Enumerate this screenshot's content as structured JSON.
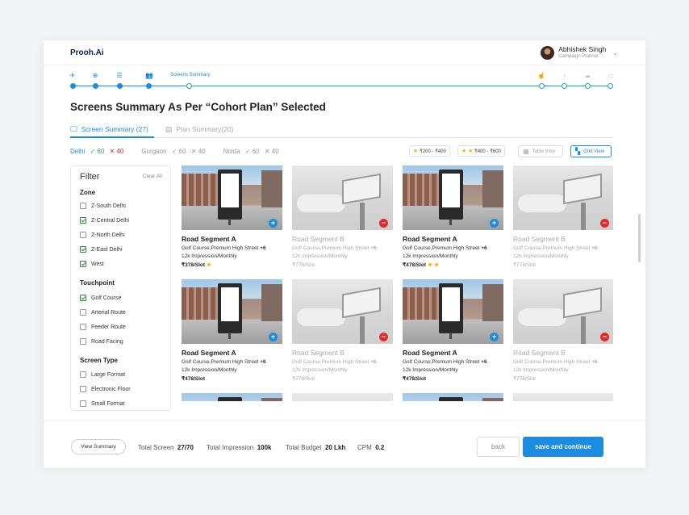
{
  "app": {
    "logo": "Prooh.Ai"
  },
  "user": {
    "name": "Abhishek Singh",
    "role": "Campaign Planner"
  },
  "stepper": {
    "current_label": "Screens Summary"
  },
  "page_title": "Screens Summary As Per “Cohort Plan” Selected",
  "tabs": [
    {
      "label": "Screen Summary (27)",
      "icon": "monitor-icon"
    },
    {
      "label": "Plan Summary(20)",
      "icon": "document-icon"
    }
  ],
  "cities": [
    {
      "name": "Delhi",
      "check": "✓ 60",
      "cross": "✕ 40"
    },
    {
      "name": "Gurgaon",
      "check": "✓ 60",
      "cross": "✕ 40"
    },
    {
      "name": "Noida",
      "check": "✓ 60",
      "cross": "✕ 40"
    }
  ],
  "price_filters": [
    "₹200 - ₹400",
    "₹400 - ₹600"
  ],
  "views": {
    "table": "Table View",
    "grid": "Grid View"
  },
  "filter": {
    "title": "Filter",
    "clear_all": "Clear All",
    "sections": [
      {
        "title": "Zone",
        "items": [
          {
            "label": "Z-South Delhi",
            "checked": false
          },
          {
            "label": "Z-Central Delhi",
            "checked": true
          },
          {
            "label": "Z-North Delhi",
            "checked": false
          },
          {
            "label": "Z-East Delhi",
            "checked": true
          },
          {
            "label": "West",
            "checked": true
          }
        ]
      },
      {
        "title": "Touchpoint",
        "items": [
          {
            "label": "Golf Course",
            "checked": true
          },
          {
            "label": "Arterial Route",
            "checked": false
          },
          {
            "label": " Feeder Route",
            "checked": false
          },
          {
            "label": "Road Facing",
            "checked": false
          }
        ]
      },
      {
        "title": "Screen Type",
        "items": [
          {
            "label": "Large Format",
            "checked": false
          },
          {
            "label": "Electronic Floor",
            "checked": false
          },
          {
            "label": "Small Format",
            "checked": false
          }
        ]
      }
    ]
  },
  "screens": [
    {
      "name": "Road Segment A",
      "location": "Golf Course,Premum High Street",
      "more": "+6",
      "impressions": "12k Impression/Monthly",
      "price": "₹378/Slot",
      "stars": 1,
      "selected": true
    },
    {
      "name": "Road Segment B",
      "location": "Golf Course,Premum High Street",
      "more": "+6",
      "impressions": "12k Impression/Monthly",
      "price": "₹778/Slot",
      "stars": 0,
      "selected": false
    },
    {
      "name": "Road Segment A",
      "location": "Golf Course,Premum High Street",
      "more": "+6",
      "impressions": "12k Impression/Monthly",
      "price": "₹478/Slot",
      "stars": 2,
      "selected": true
    },
    {
      "name": "Road Segment B",
      "location": "Golf Course,Premum High Street",
      "more": "+6",
      "impressions": "12k Impression/Monthly",
      "price": "₹778/Slot",
      "stars": 0,
      "selected": false
    },
    {
      "name": "Road Segment A",
      "location": "Golf Course,Premum High Street",
      "more": "+6",
      "impressions": "12k Impression/Monthly",
      "price": "₹478/Slot",
      "stars": 0,
      "selected": true
    },
    {
      "name": "Road Segment B",
      "location": "Golf Course,Premum High Street",
      "more": "+6",
      "impressions": "12k Impression/Monthly",
      "price": "₹778/Slot",
      "stars": 0,
      "selected": false
    },
    {
      "name": "Road Segment A",
      "location": "Golf Course,Premum High Street",
      "more": "+6",
      "impressions": "12k Impression/Monthly",
      "price": "₹478/Slot",
      "stars": 0,
      "selected": true
    },
    {
      "name": "Road Segment B",
      "location": "Golf Course,Premum High Street",
      "more": "+6",
      "impressions": "12k Impression/Monthly",
      "price": "₹778/Slot",
      "stars": 0,
      "selected": false
    },
    {
      "name": "",
      "location": "",
      "more": "",
      "impressions": "",
      "price": "",
      "stars": 0,
      "selected": true
    },
    {
      "name": "",
      "location": "",
      "more": "",
      "impressions": "",
      "price": "",
      "stars": 0,
      "selected": false
    },
    {
      "name": "",
      "location": "",
      "more": "",
      "impressions": "",
      "price": "",
      "stars": 0,
      "selected": true
    },
    {
      "name": "",
      "location": "",
      "more": "",
      "impressions": "",
      "price": "",
      "stars": 0,
      "selected": false
    }
  ],
  "footer": {
    "view_summary": "View Summary",
    "total_screen_label": "Total Screen",
    "total_screen_value": "27/70",
    "total_impression_label": "Total Impression",
    "total_impression_value": "100k",
    "total_budget_label": "Total Budget",
    "total_budget_value": "20 Lkh",
    "cpm_label": "CPM",
    "cpm_value": "0.2",
    "back": "back",
    "save": "save and continue"
  },
  "colors": {
    "accent": "#1c8ce0",
    "success": "#2fa84f",
    "danger": "#e12c2c",
    "star": "#f4b400"
  }
}
